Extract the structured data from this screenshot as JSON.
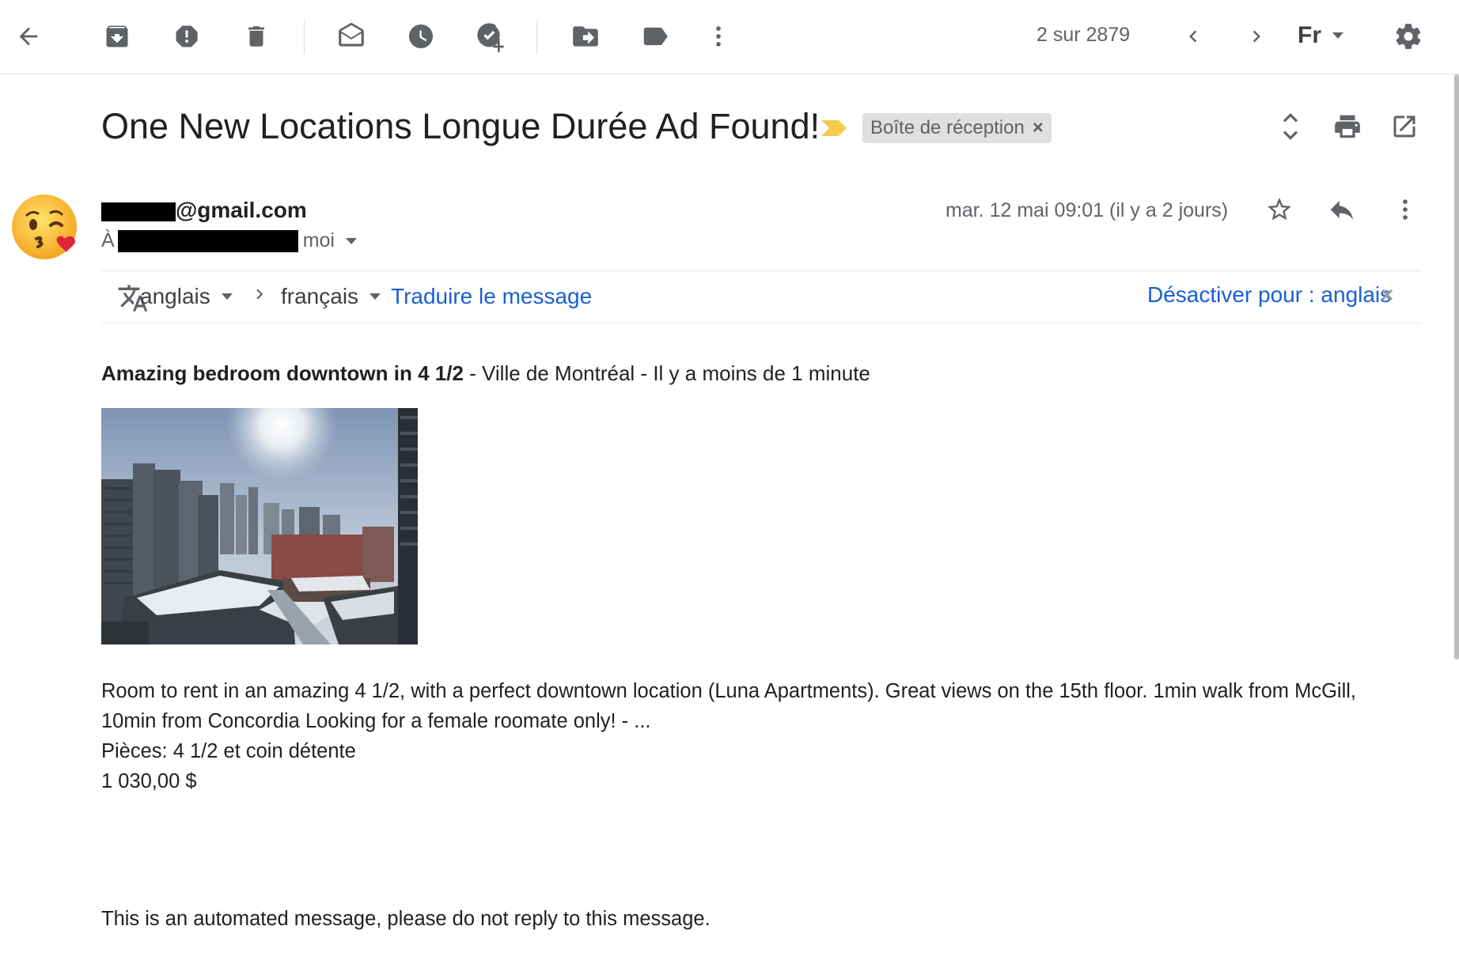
{
  "toolbar": {
    "back_icon": "arrow-left-icon",
    "counter": "2 sur 2879",
    "language_label": "Fr",
    "icons": [
      "archive-icon",
      "report-spam-icon",
      "delete-icon",
      "mark-unread-icon",
      "snooze-icon",
      "add-task-icon",
      "move-to-icon",
      "label-icon",
      "more-vert-icon",
      "chevron-left-icon",
      "chevron-right-icon",
      "settings-icon"
    ]
  },
  "message": {
    "subject": "One New Locations Longue Durée Ad Found!",
    "label_chip": "Boîte de réception",
    "label_chip_close": "×",
    "sender_email_suffix": "@gmail.com",
    "to_prefix": "À",
    "to_me": "moi",
    "date": "mar. 12 mai 09:01 (il y a 2 jours)",
    "avatar": "kissing-face-emoji"
  },
  "translate": {
    "source_lang": "anglais",
    "arrow": "›",
    "target_lang": "français",
    "translate_link": "Traduire le message",
    "disable_link": "Désactiver pour : anglais",
    "close": "×"
  },
  "body": {
    "headline_bold": "Amazing bedroom downtown in 4 1/2",
    "headline_rest": " - Ville de Montréal - Il y a moins de 1 minute",
    "description": "Room to rent in an amazing 4 1/2, with a perfect downtown location (Luna Apartments). Great views on the 15th floor. 1min walk from McGill, 10min from Concordia Looking for a female roomate only! - ...",
    "rooms": "Pièces: 4 1/2 et coin détente",
    "price": "1 030,00 $",
    "footer": "This is an automated message, please do not reply to this message."
  },
  "colors": {
    "link_blue": "#1a5fd4",
    "importance_marker": "#f7cb4d",
    "chip_bg": "#e0e0e0",
    "icon_gray": "#5f6368"
  }
}
